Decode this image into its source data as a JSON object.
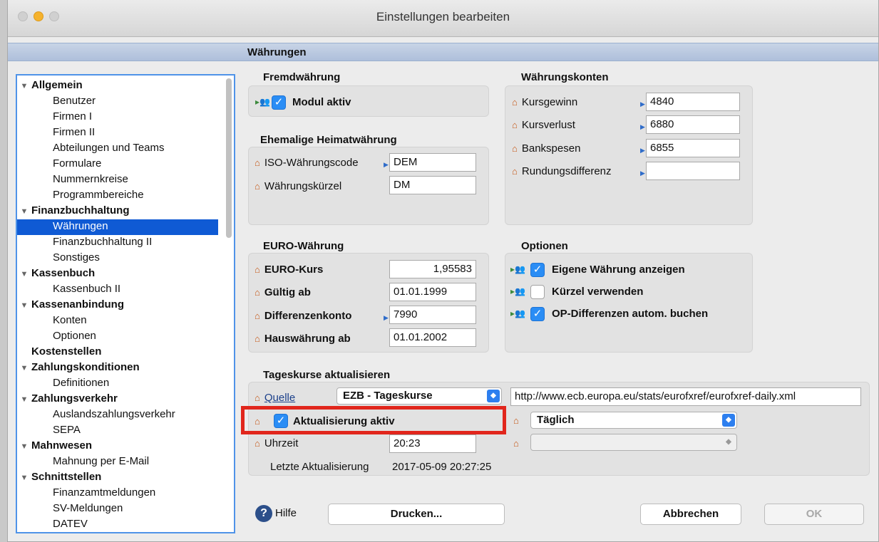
{
  "window": {
    "title": "Einstellungen bearbeiten"
  },
  "section": {
    "title": "Währungen"
  },
  "tree": {
    "items": [
      {
        "label": "Allgemein",
        "bold": true,
        "expanded": true
      },
      {
        "label": "Benutzer"
      },
      {
        "label": "Firmen I"
      },
      {
        "label": "Firmen II"
      },
      {
        "label": "Abteilungen und Teams"
      },
      {
        "label": "Formulare"
      },
      {
        "label": "Nummernkreise"
      },
      {
        "label": "Programmbereiche"
      },
      {
        "label": "Finanzbuchhaltung",
        "bold": true,
        "expanded": true
      },
      {
        "label": "Währungen",
        "selected": true
      },
      {
        "label": "Finanzbuchhaltung II"
      },
      {
        "label": "Sonstiges"
      },
      {
        "label": "Kassenbuch",
        "bold": true,
        "expanded": true
      },
      {
        "label": "Kassenbuch II"
      },
      {
        "label": "Kassenanbindung",
        "bold": true,
        "expanded": true
      },
      {
        "label": "Konten"
      },
      {
        "label": "Optionen"
      },
      {
        "label": "Kostenstellen",
        "bold": true
      },
      {
        "label": "Zahlungskonditionen",
        "bold": true,
        "expanded": true
      },
      {
        "label": "Definitionen"
      },
      {
        "label": "Zahlungsverkehr",
        "bold": true,
        "expanded": true
      },
      {
        "label": "Auslandszahlungsverkehr"
      },
      {
        "label": "SEPA"
      },
      {
        "label": "Mahnwesen",
        "bold": true,
        "expanded": true
      },
      {
        "label": "Mahnung per E-Mail"
      },
      {
        "label": "Schnittstellen",
        "bold": true,
        "expanded": true
      },
      {
        "label": "Finanzamtmeldungen"
      },
      {
        "label": "SV-Meldungen"
      },
      {
        "label": "DATEV"
      }
    ]
  },
  "fremd": {
    "title": "Fremdwährung",
    "modul_label": "Modul aktiv",
    "modul_checked": true
  },
  "ehemalig": {
    "title": "Ehemalige Heimatwährung",
    "iso_label": "ISO-Währungscode",
    "iso_value": "DEM",
    "kuerzel_label": "Währungskürzel",
    "kuerzel_value": "DM"
  },
  "konten": {
    "title": "Währungskonten",
    "rows": [
      {
        "label": "Kursgewinn",
        "value": "4840"
      },
      {
        "label": "Kursverlust",
        "value": "6880"
      },
      {
        "label": "Bankspesen",
        "value": "6855"
      },
      {
        "label": "Rundungsdifferenz",
        "value": ""
      }
    ]
  },
  "euro": {
    "title": "EURO-Währung",
    "kurs_label": "EURO-Kurs",
    "kurs_value": "1,95583",
    "gueltig_label": "Gültig ab",
    "gueltig_value": "01.01.1999",
    "diff_label": "Differenzenkonto",
    "diff_value": "7990",
    "haus_label": "Hauswährung ab",
    "haus_value": "01.01.2002"
  },
  "optionen": {
    "title": "Optionen",
    "items": [
      {
        "label": "Eigene Währung anzeigen",
        "checked": true
      },
      {
        "label": "Kürzel verwenden",
        "checked": false
      },
      {
        "label": "OP-Differenzen autom. buchen",
        "checked": true
      }
    ]
  },
  "tageskurse": {
    "title": "Tageskurse aktualisieren",
    "quelle_label": "Quelle",
    "quelle_value": "EZB - Tageskurse",
    "url_value": "http://www.ecb.europa.eu/stats/eurofxref/eurofxref-daily.xml",
    "aktiv_label": "Aktualisierung aktiv",
    "aktiv_checked": true,
    "intervall_value": "Täglich",
    "uhrzeit_label": "Uhrzeit",
    "uhrzeit_value": "20:23",
    "letzte_label": "Letzte Aktualisierung",
    "letzte_value": "2017-05-09 20:27:25"
  },
  "footer": {
    "help_label": "Hilfe",
    "print_label": "Drucken...",
    "cancel_label": "Abbrechen",
    "ok_label": "OK"
  },
  "colors": {
    "accent": "#2a8df5",
    "selection": "#0f5ad4",
    "highlight": "#e1261c",
    "house_icon": "#c65a1a"
  }
}
